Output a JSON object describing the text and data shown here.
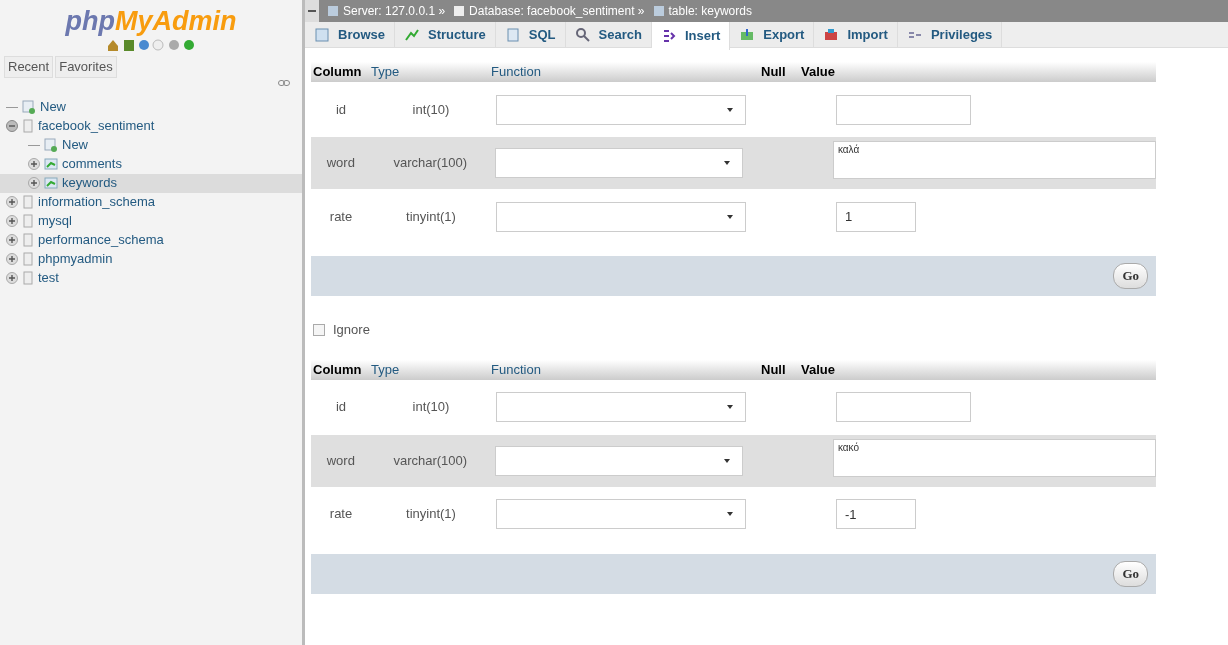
{
  "sidebar": {
    "logo": {
      "part1": "php",
      "part2": "MyAdmin"
    },
    "tabs": [
      {
        "label": "Recent",
        "selected": false
      },
      {
        "label": "Favorites",
        "selected": false
      }
    ],
    "tree": [
      {
        "label": "New",
        "kind": "new",
        "selected": false
      },
      {
        "label": "facebook_sentiment",
        "kind": "db",
        "expanded": true,
        "selected": false,
        "children": [
          {
            "label": "New",
            "kind": "new",
            "selected": false
          },
          {
            "label": "comments",
            "kind": "table",
            "expanded": false,
            "selected": false
          },
          {
            "label": "keywords",
            "kind": "table",
            "expanded": false,
            "selected": true
          }
        ]
      },
      {
        "label": "information_schema",
        "kind": "db",
        "expanded": false,
        "selected": false
      },
      {
        "label": "mysql",
        "kind": "db",
        "expanded": false,
        "selected": false
      },
      {
        "label": "performance_schema",
        "kind": "db",
        "expanded": false,
        "selected": false
      },
      {
        "label": "phpmyadmin",
        "kind": "db",
        "expanded": false,
        "selected": false
      },
      {
        "label": "test",
        "kind": "db",
        "expanded": false,
        "selected": false
      }
    ]
  },
  "breadcrumb": [
    {
      "kind": "server",
      "label": "Server: 127.0.0.1 »"
    },
    {
      "kind": "db",
      "label": "Database: facebook_sentiment »"
    },
    {
      "kind": "table",
      "label": "table: keywords"
    }
  ],
  "tabs": [
    {
      "label": "Browse",
      "kind": "browse",
      "selected": false
    },
    {
      "label": "Structure",
      "kind": "structure",
      "selected": false
    },
    {
      "label": "SQL",
      "kind": "sql",
      "selected": false
    },
    {
      "label": "Search",
      "kind": "search",
      "selected": false
    },
    {
      "label": "Insert",
      "kind": "insert",
      "selected": true
    },
    {
      "label": "Export",
      "kind": "export",
      "selected": false
    },
    {
      "label": "Import",
      "kind": "import",
      "selected": false
    },
    {
      "label": "Privileges",
      "kind": "privileges",
      "selected": false
    }
  ],
  "forms": [
    {
      "columns": [
        "Column",
        "Type",
        "Function",
        "Null",
        "Value"
      ],
      "rows": [
        {
          "column": "id",
          "type": "int(10)",
          "kind": "input",
          "value": ""
        },
        {
          "column": "word",
          "type": "varchar(100)",
          "kind": "textarea",
          "value": "καλά"
        },
        {
          "column": "rate",
          "type": "tinyint(1)",
          "kind": "short",
          "value": "1"
        }
      ],
      "go": "Go"
    },
    {
      "ignore": {
        "label": "Ignore",
        "checked": false
      },
      "columns": [
        "Column",
        "Type",
        "Function",
        "Null",
        "Value"
      ],
      "rows": [
        {
          "column": "id",
          "type": "int(10)",
          "kind": "input",
          "value": ""
        },
        {
          "column": "word",
          "type": "varchar(100)",
          "kind": "textarea",
          "value": "κακό"
        },
        {
          "column": "rate",
          "type": "tinyint(1)",
          "kind": "short",
          "value": "-1"
        }
      ],
      "go": "Go"
    }
  ]
}
